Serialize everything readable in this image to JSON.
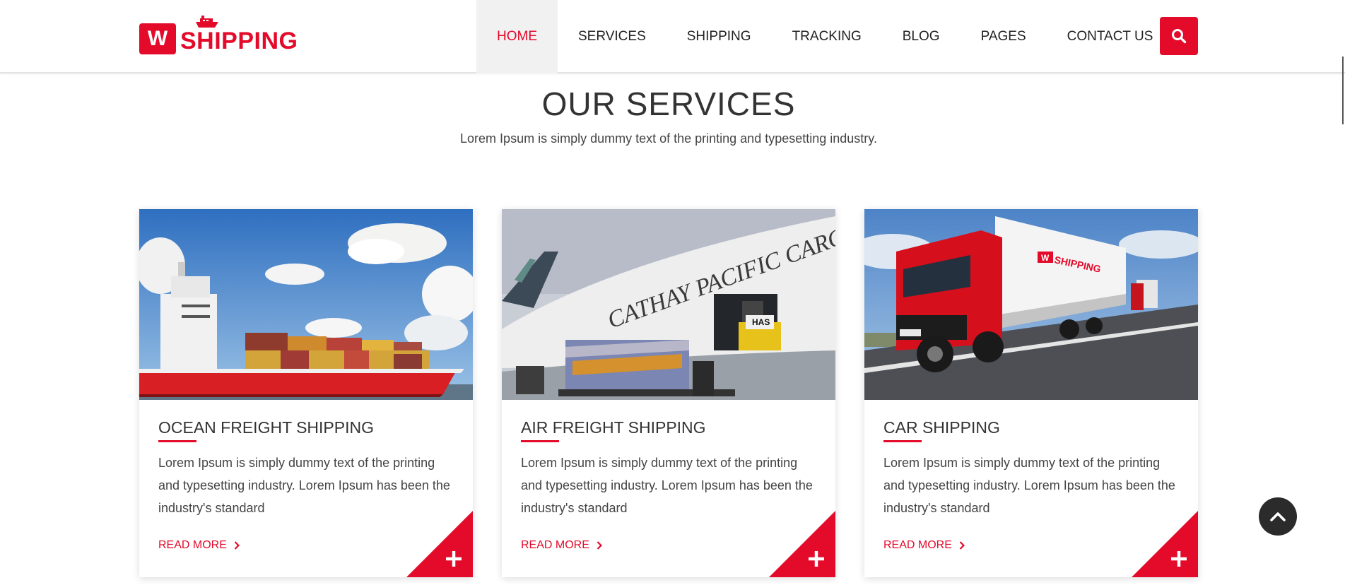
{
  "brand": {
    "logo_letter": "W",
    "logo_text": "SHIPPING",
    "accent_color": "#e30a2a"
  },
  "nav": {
    "items": [
      {
        "label": "HOME",
        "active": true
      },
      {
        "label": "SERVICES"
      },
      {
        "label": "SHIPPING"
      },
      {
        "label": "TRACKING"
      },
      {
        "label": "BLOG"
      },
      {
        "label": "PAGES"
      },
      {
        "label": "CONTACT US"
      }
    ],
    "search_icon": "search-icon"
  },
  "section": {
    "title": "OUR SERVICES",
    "subtitle": "Lorem Ipsum is simply dummy text of the printing and typesetting industry."
  },
  "cards": [
    {
      "title": "OCEAN FREIGHT SHIPPING",
      "text": "Lorem Ipsum is simply dummy text of the printing and typesetting industry. Lorem Ipsum has been the industry's standard",
      "read_more": "READ MORE",
      "image": "container-ship"
    },
    {
      "title": "AIR FREIGHT SHIPPING",
      "text": "Lorem Ipsum is simply dummy text of the printing and typesetting industry. Lorem Ipsum has been the industry's standard",
      "read_more": "READ MORE",
      "image": "cargo-plane",
      "image_text": "CATHAY PACIFIC CARGO",
      "image_label": "HAS"
    },
    {
      "title": "CAR SHIPPING",
      "text": "Lorem Ipsum is simply dummy text of the printing and typesetting industry. Lorem Ipsum has been the industry's standard",
      "read_more": "READ MORE",
      "image": "red-truck",
      "image_text": "SHIPPING",
      "image_logo_letter": "W"
    }
  ],
  "scroll_top_icon": "chevron-up-icon"
}
